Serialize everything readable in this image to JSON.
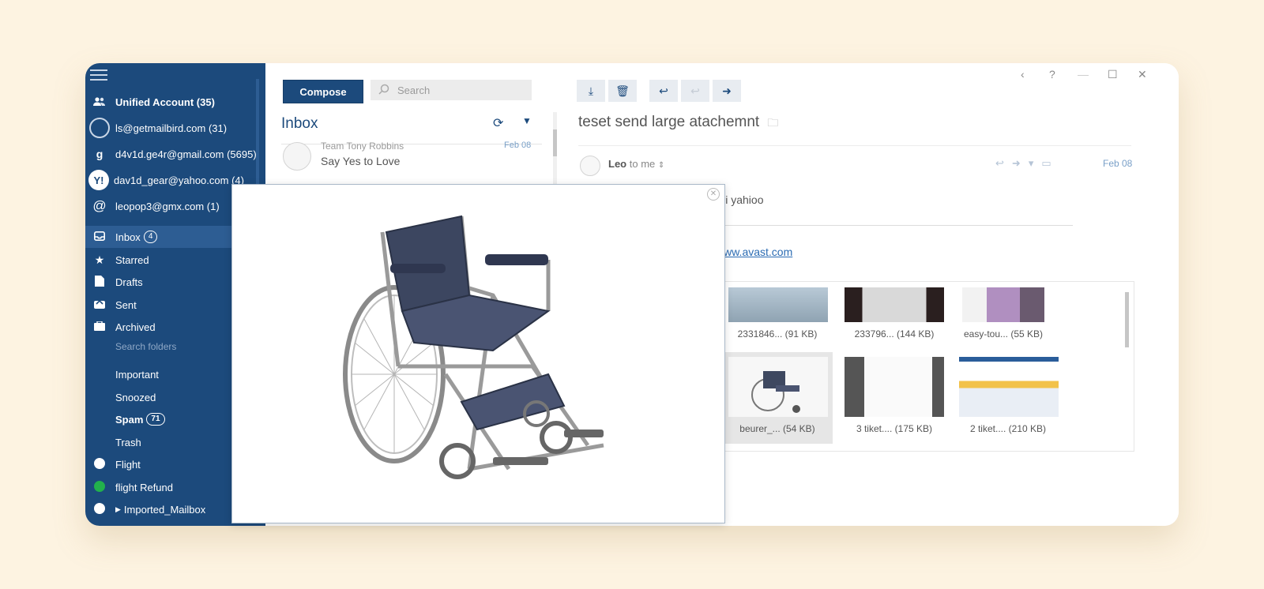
{
  "sidebar": {
    "accounts": [
      {
        "label": "Unified Account (35)",
        "icon": "people-icon"
      },
      {
        "label": "ls@getmailbird.com (31)",
        "icon": "mailbird-icon"
      },
      {
        "label": "d4v1d.ge4r@gmail.com (5695)",
        "icon": "google-icon"
      },
      {
        "label": "dav1d_gear@yahoo.com (4)",
        "icon": "yahoo-icon"
      },
      {
        "label": "leopop3@gmx.com (1)",
        "icon": "at-icon"
      }
    ],
    "folders": [
      {
        "label": "Inbox",
        "badge": "4"
      },
      {
        "label": "Starred"
      },
      {
        "label": "Drafts"
      },
      {
        "label": "Sent"
      },
      {
        "label": "Archived"
      }
    ],
    "search_folders": "Search folders",
    "labels": [
      {
        "label": "Important"
      },
      {
        "label": "Snoozed"
      },
      {
        "label": "Spam",
        "badge": "71"
      },
      {
        "label": "Trash"
      },
      {
        "label": "Flight",
        "color": "#ffffff"
      },
      {
        "label": "flight Refund",
        "color": "#22b14c"
      },
      {
        "label": "Imported_Mailbox",
        "color": "#ffffff"
      }
    ],
    "sidebar_color": "#1c4a7c"
  },
  "list": {
    "compose_label": "Compose",
    "search_placeholder": "Search",
    "title": "Inbox",
    "messages": [
      {
        "sender": "Team Tony Robbins",
        "subject": "Say Yes to Love",
        "date": "Feb 08"
      }
    ]
  },
  "reader": {
    "subject": "teset send large atachemnt",
    "from_name": "Leo",
    "to_text": "to me",
    "date": "Feb 08",
    "body_text": "dari yahioo",
    "link_text": "www.avast.com",
    "attachments": [
      {
        "label": "2331846... (91 KB)"
      },
      {
        "label": "233796... (144 KB)"
      },
      {
        "label": "easy-tou... (55 KB)"
      },
      {
        "label": "beurer_... (54 KB)"
      },
      {
        "label": "3 tiket.... (175 KB)"
      },
      {
        "label": "2 tiket.... (210 KB)"
      }
    ]
  },
  "preview": {
    "image": "wheelchair-image"
  }
}
